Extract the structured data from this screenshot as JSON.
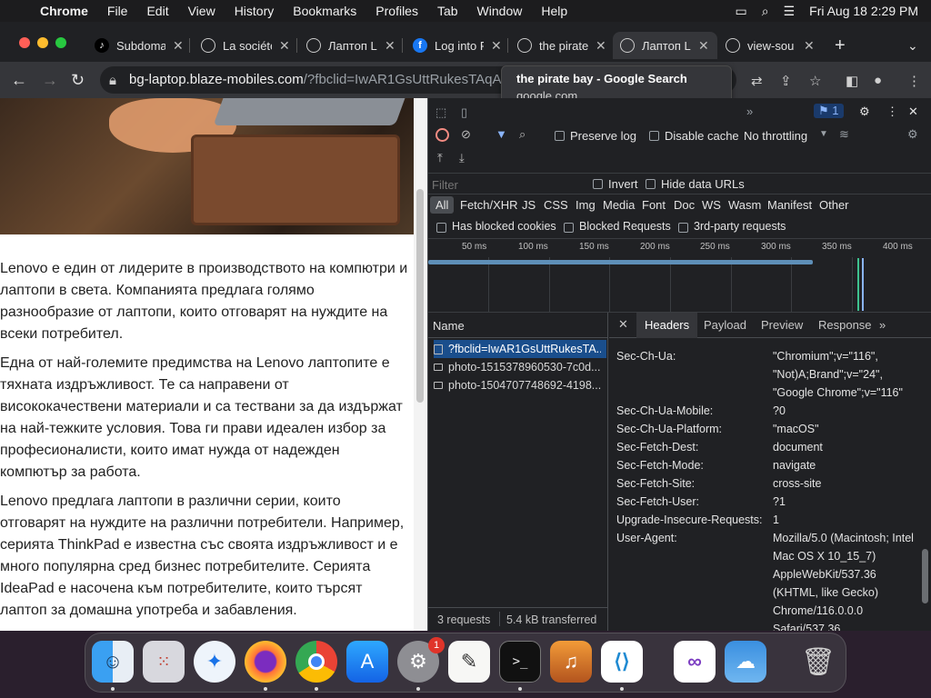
{
  "menubar": {
    "app": "Chrome",
    "items": [
      "File",
      "Edit",
      "View",
      "History",
      "Bookmarks",
      "Profiles",
      "Tab",
      "Window",
      "Help"
    ],
    "clock": "Fri Aug 18  2:29 PM"
  },
  "tabs": [
    {
      "title": "Subdomains",
      "favicon": "tiktok-icon"
    },
    {
      "title": "La société",
      "favicon": "globe-icon"
    },
    {
      "title": "Лаптоп L",
      "favicon": "globe-icon"
    },
    {
      "title": "Log into F",
      "favicon": "facebook-icon"
    },
    {
      "title": "the pirate",
      "favicon": "globe-icon"
    },
    {
      "title": "Лаптоп L",
      "favicon": "globe-icon",
      "active": true
    },
    {
      "title": "view-sou",
      "favicon": "globe-icon"
    }
  ],
  "address": {
    "host": "bg-laptop.blaze-mobiles.com",
    "path": "/?fbclid=IwAR1GsUttRukesTAqA..."
  },
  "tooltip": {
    "title": "the pirate bay - Google Search",
    "domain": "google.com"
  },
  "article": {
    "p1": "Lenovo е един от лидерите в производството на компютри и лаптопи в света. Компанията предлага голямо разнообразие от лаптопи, които отговарят на нуждите на всеки потребител.",
    "p2": "Една от най-големите предимства на Lenovo лаптопите е тяхната издръжливост. Те са направени от висококачествени материали и са тествани за да издържат на най-тежките условия. Това ги прави идеален избор за професионалисти, които имат нужда от надежден компютър за работа.",
    "p3": "Lenovo предлага лаптопи в различни серии, които отговарят на нуждите на различни потребители. Например, серията ThinkPad е известна със своята издръжливост и е много популярна сред бизнес потребителите. Серията IdeaPad е насочена към потребителите, които търсят лаптоп за домашна употреба и забавления."
  },
  "devtools": {
    "issues_count": "1",
    "preserve_log": "Preserve log",
    "disable_cache": "Disable cache",
    "throttling": "No throttling",
    "filter_placeholder": "Filter",
    "invert": "Invert",
    "hide_data_urls": "Hide data URLs",
    "types": [
      "All",
      "Fetch/XHR",
      "JS",
      "CSS",
      "Img",
      "Media",
      "Font",
      "Doc",
      "WS",
      "Wasm",
      "Manifest",
      "Other"
    ],
    "has_blocked_cookies": "Has blocked cookies",
    "blocked_requests": "Blocked Requests",
    "third_party": "3rd-party requests",
    "timeline_ticks": [
      "50 ms",
      "100 ms",
      "150 ms",
      "200 ms",
      "250 ms",
      "300 ms",
      "350 ms",
      "400 ms"
    ],
    "name_header": "Name",
    "requests": [
      "?fbclid=IwAR1GsUttRukesTA...",
      "photo-1515378960530-7c0d...",
      "photo-1504707748692-4198..."
    ],
    "detail_tabs": [
      "Headers",
      "Payload",
      "Preview",
      "Response"
    ],
    "headers": [
      {
        "name": "Sec-Ch-Ua:",
        "value": [
          "\"Chromium\";v=\"116\",",
          "\"Not)A;Brand\";v=\"24\",",
          "\"Google Chrome\";v=\"116\""
        ]
      },
      {
        "name": "Sec-Ch-Ua-Mobile:",
        "value": [
          "?0"
        ]
      },
      {
        "name": "Sec-Ch-Ua-Platform:",
        "value": [
          "\"macOS\""
        ]
      },
      {
        "name": "Sec-Fetch-Dest:",
        "value": [
          "document"
        ]
      },
      {
        "name": "Sec-Fetch-Mode:",
        "value": [
          "navigate"
        ]
      },
      {
        "name": "Sec-Fetch-Site:",
        "value": [
          "cross-site"
        ]
      },
      {
        "name": "Sec-Fetch-User:",
        "value": [
          "?1"
        ]
      },
      {
        "name": "Upgrade-Insecure-Requests:",
        "value": [
          "1"
        ]
      },
      {
        "name": "User-Agent:",
        "value": [
          "Mozilla/5.0 (Macintosh; Intel",
          "Mac OS X 10_15_7)",
          "AppleWebKit/537.36",
          "(KHTML, like Gecko)",
          "Chrome/116.0.0.0",
          "Safari/537.36"
        ]
      }
    ],
    "status_requests": "3 requests",
    "status_transferred": "5.4 kB transferred"
  },
  "dock": {
    "apps": [
      "finder-icon",
      "launchpad-icon",
      "safari-icon",
      "firefox-icon",
      "chrome-icon",
      "app-store-icon",
      "system-settings-icon",
      "textedit-icon",
      "terminal-icon",
      "garageband-icon",
      "vscode-icon",
      "visual-studio-icon",
      "weather-icon",
      "trash-icon"
    ],
    "settings_badge": "1"
  }
}
